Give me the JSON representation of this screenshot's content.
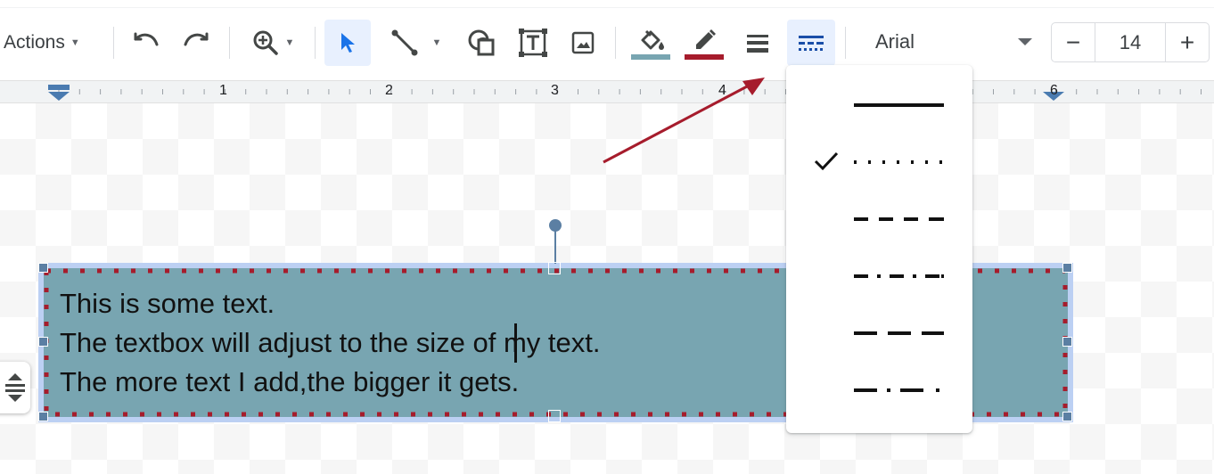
{
  "toolbar": {
    "actions_label": "Actions",
    "icons": [
      "undo-icon",
      "redo-icon",
      "zoom-icon",
      "select-icon",
      "line-icon",
      "shape-icon",
      "textbox-icon",
      "image-icon",
      "fill-color-icon",
      "border-color-icon",
      "border-weight-icon",
      "border-dash-icon"
    ],
    "fill_color": "#78a5b1",
    "border_color": "#a61c2c",
    "font_name": "Arial",
    "font_size": "14",
    "decrease_label": "−",
    "increase_label": "+"
  },
  "ruler": {
    "numbers": [
      "1",
      "2",
      "3",
      "4",
      "6"
    ]
  },
  "textbox": {
    "lines": [
      "This is some text.",
      "The textbox will adjust to the size of my text.",
      "The more text I add,the bigger it gets."
    ],
    "fill": "#78a5b1",
    "border_color": "#a61c2c",
    "border_style": "dotted"
  },
  "dash_menu": {
    "options": [
      "solid",
      "dotted",
      "dashed",
      "dash-dot",
      "long-dash",
      "long-dash-dot"
    ],
    "selected": "dotted"
  },
  "annotation": {
    "arrow_color": "#a61c2c"
  }
}
